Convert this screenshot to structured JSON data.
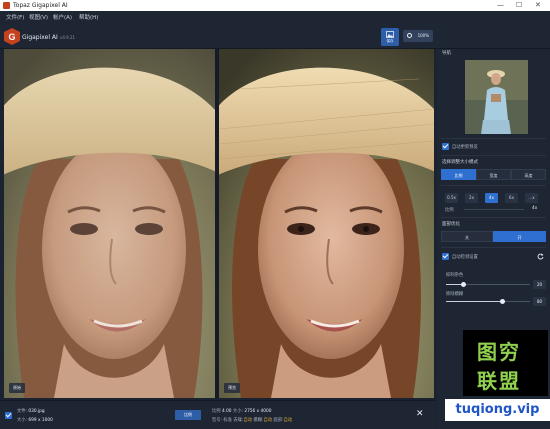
{
  "window": {
    "title": "Topaz Gigapixel AI",
    "controls": [
      "—",
      "☐",
      "✕"
    ]
  },
  "menu": [
    "文件(F)",
    "视图(V)",
    "帐户(A)",
    "帮助(H)"
  ],
  "app": {
    "name": "Gigapixel AI",
    "version": "v4.9.21"
  },
  "toolbar": {
    "save_label": "保存",
    "zoom_label": "100%"
  },
  "viewer": {
    "left_tag": "原始",
    "right_tag": "预览"
  },
  "bottom": {
    "filename_label": "文件:",
    "filename": "030.jpg",
    "size_label": "大小:",
    "size": "699 x 1000",
    "ratio_button": "比例",
    "scale_label": "比例",
    "scale": "4.00",
    "outsize_label": "大小:",
    "outsize": "2756 x 4000",
    "model_label": "型号: 标准",
    "denoise_label": "去噪:",
    "denoise": "自动",
    "blur_label": "模糊:",
    "blur": "自动",
    "face_label": "面部:",
    "face": "自动"
  },
  "panel": {
    "nav_title": "导航",
    "auto_update": "自动更新预览",
    "resize_title": "选择调整大小模式",
    "resize_modes": [
      "比例",
      "宽度",
      "高度"
    ],
    "scale_opts": [
      "0.5x",
      "2x",
      "4x",
      "6x",
      "...x"
    ],
    "scale_caption": "比例",
    "scale_selected": "4x",
    "face_title": "面部优化",
    "face_opts": [
      "关",
      "开"
    ],
    "auto_settings": "自动检测设置",
    "denoise_label": "抑制杂色",
    "denoise_value": "20",
    "blur_label": "移除模糊",
    "blur_value": "80"
  },
  "watermark": {
    "line1": "图穷",
    "line2": "联盟",
    "url": "tuqiong.vip"
  },
  "colors": {
    "accent": "#2f6fd0",
    "panel": "#1e2533",
    "watermark_green": "#8fd14f"
  }
}
